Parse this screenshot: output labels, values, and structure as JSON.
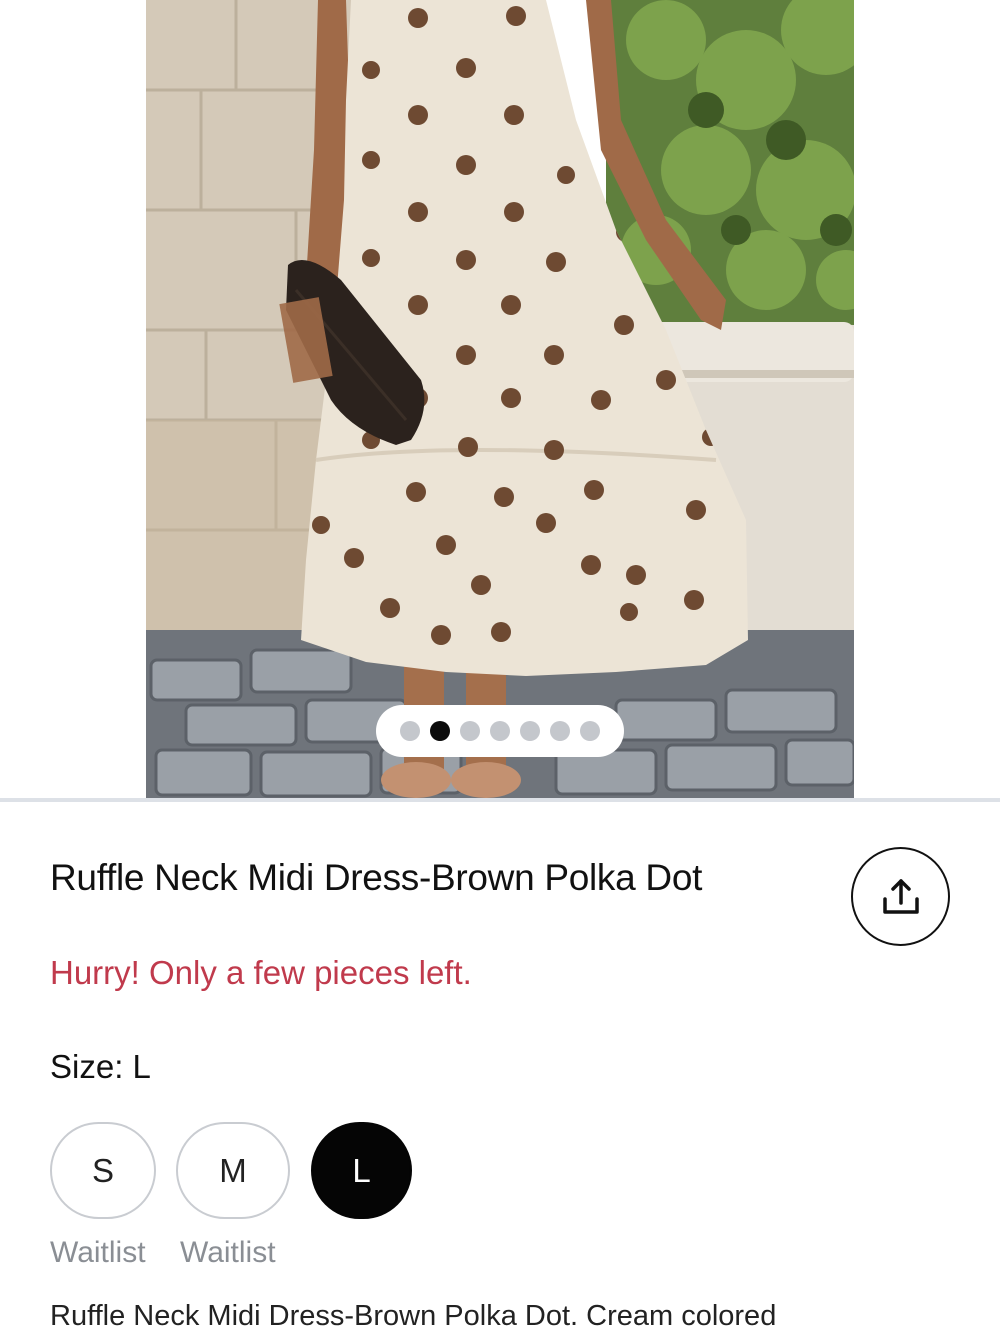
{
  "gallery": {
    "image_alt": "Model wearing cream dress with brown polka dots",
    "pager": {
      "total": 7,
      "active_index": 1
    }
  },
  "product": {
    "title": "Ruffle Neck Midi Dress-Brown Polka Dot",
    "stock_message": "Hurry! Only a few pieces left.",
    "size_prefix": "Size:",
    "selected_size": "L",
    "sizes": [
      {
        "label": "S",
        "status": "Waitlist",
        "selected": false
      },
      {
        "label": "M",
        "status": "Waitlist",
        "selected": false
      },
      {
        "label": "L",
        "status": "",
        "selected": true
      }
    ],
    "description": "Ruffle Neck Midi Dress-Brown Polka Dot. Cream colored"
  },
  "icons": {
    "share": "share-icon"
  },
  "colors": {
    "stock_alert": "#c03a4c",
    "selected_size_bg": "#050505",
    "waitlist_text": "#8a8e94"
  }
}
